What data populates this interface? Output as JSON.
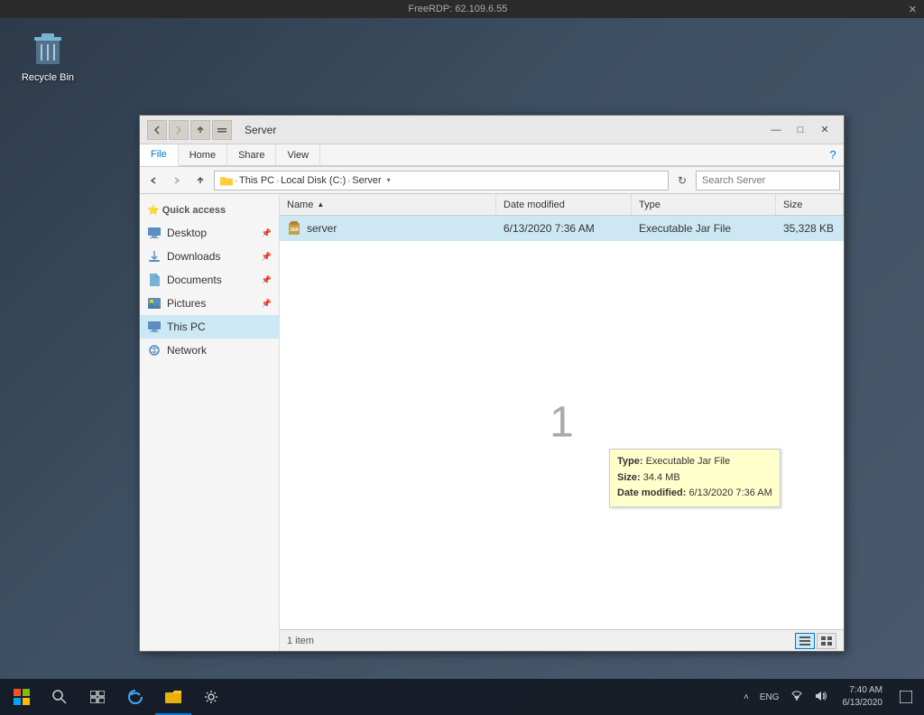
{
  "freerdp": {
    "title": "FreeRDP: 62.109.6.55",
    "close": "✕"
  },
  "desktop": {
    "recycle_bin": {
      "label": "Recycle Bin"
    }
  },
  "explorer": {
    "title": "Server",
    "nav": {
      "back": "‹",
      "forward": "›",
      "up": "↑"
    },
    "controls": {
      "minimize": "—",
      "maximize": "□",
      "close": "✕"
    },
    "ribbon": {
      "tabs": [
        "File",
        "Home",
        "Share",
        "View"
      ],
      "active_tab": "File",
      "help": "?"
    },
    "address": {
      "this_pc": "This PC",
      "local_disk": "Local Disk (C:)",
      "server": "Server",
      "search_placeholder": "Search Server"
    },
    "sidebar": {
      "quick_access_label": "Quick access",
      "items": [
        {
          "id": "desktop",
          "label": "Desktop",
          "pinned": true
        },
        {
          "id": "downloads",
          "label": "Downloads",
          "pinned": true
        },
        {
          "id": "documents",
          "label": "Documents",
          "pinned": true
        },
        {
          "id": "pictures",
          "label": "Pictures",
          "pinned": true
        },
        {
          "id": "this-pc",
          "label": "This PC",
          "active": true
        },
        {
          "id": "network",
          "label": "Network"
        }
      ]
    },
    "file_list": {
      "columns": [
        "Name",
        "Date modified",
        "Type",
        "Size"
      ],
      "files": [
        {
          "name": "server",
          "date_modified": "6/13/2020 7:36 AM",
          "type": "Executable Jar File",
          "size": "35,328 KB",
          "selected": true
        }
      ]
    },
    "tooltip": {
      "type_label": "Type:",
      "type_value": "Executable Jar File",
      "size_label": "Size:",
      "size_value": "34.4 MB",
      "date_label": "Date modified:",
      "date_value": "6/13/2020 7:36 AM"
    },
    "center_number": "1",
    "status": {
      "count": "1 item"
    },
    "view_buttons": {
      "details": "☰",
      "tiles": "⊞"
    }
  },
  "taskbar": {
    "start_icon": "⊞",
    "search_icon": "🔍",
    "task_view_icon": "⧉",
    "edge_icon": "e",
    "explorer_icon": "📁",
    "settings_icon": "⚙",
    "systray": {
      "chevron": "˄",
      "network": "🌐",
      "volume": "🔊",
      "keyboard": "ENG"
    },
    "clock": {
      "time": "7:40 AM",
      "date": "6/13/2020"
    },
    "notification": "□"
  }
}
